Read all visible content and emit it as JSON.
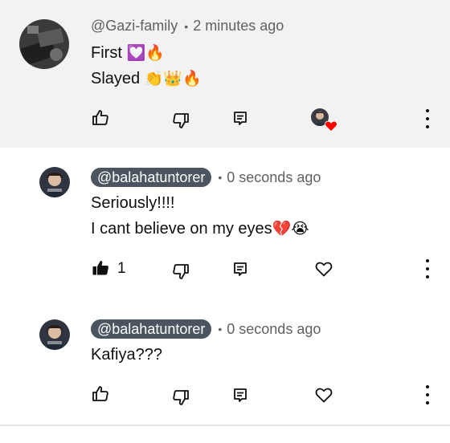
{
  "comments": [
    {
      "handle": "@Gazi-family",
      "separator": "•",
      "time": "2 minutes ago",
      "lines": [
        "First",
        "Slayed"
      ],
      "line_emojis": [
        "💟🔥",
        "👏👑🔥"
      ],
      "like_count": "",
      "creator_hearted": true
    },
    {
      "handle": "@balahatuntorer",
      "separator": "•",
      "time": "0 seconds ago",
      "lines": [
        "Seriously!!!!",
        "I cant believe on my eyes"
      ],
      "line_emojis": [
        "",
        "💔😭"
      ],
      "like_count": "1",
      "liked": true
    },
    {
      "handle": "@balahatuntorer",
      "separator": "•",
      "time": "0 seconds ago",
      "lines": [
        "Kafiya???"
      ],
      "line_emojis": [
        ""
      ],
      "like_count": ""
    }
  ],
  "icons": {
    "like": "thumb-up-icon",
    "dislike": "thumb-down-icon",
    "reply": "reply-icon",
    "heart": "heart-icon",
    "more": "more-vertical-icon"
  },
  "colors": {
    "highlight_bg": "#f2f2f2",
    "pill_bg": "#4b5560",
    "heart_red": "#ff0000"
  }
}
